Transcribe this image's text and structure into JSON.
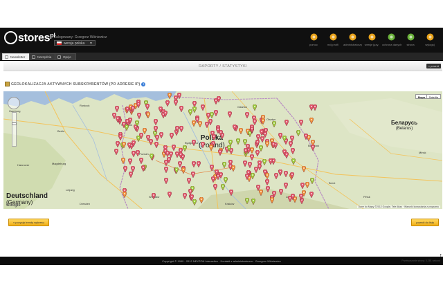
{
  "header": {
    "logo_text": "stores",
    "logo_suffix": "pl",
    "logged_as": "Zalogowany: Grzegorz Wiśniewicz",
    "language_select": "wersja polska",
    "icons": [
      {
        "name": "pomoc-icon",
        "label": "pomoc",
        "color": "#e9a31b"
      },
      {
        "name": "moj-profil-icon",
        "label": "mój profil",
        "color": "#e9a31b"
      },
      {
        "name": "administratorzy-icon",
        "label": "administratorzy",
        "color": "#e9a31b"
      },
      {
        "name": "wersja-jezykowa-icon",
        "label": "wersje języ.",
        "color": "#e9a31b"
      },
      {
        "name": "ochrona-danych-icon",
        "label": "ochrona danych",
        "color": "#6ab23a"
      },
      {
        "name": "home-icon",
        "label": "strona",
        "color": "#6ab23a"
      },
      {
        "name": "wyloguj-icon",
        "label": "wyloguj",
        "color": "#e9a31b"
      }
    ]
  },
  "tabs": [
    {
      "label": "Newsletter",
      "active": true
    },
    {
      "label": "Narzędzia",
      "active": false
    },
    {
      "label": "Opcje",
      "active": false
    }
  ],
  "page": {
    "title": "RAPORTY / STATYSTYKI",
    "back_button": "« powrót"
  },
  "section": {
    "title": "GEOLOKALIZACJA AKTYWNYCH SUBSKRYBENTÓW (PO ADRESIE IP)",
    "help": "?"
  },
  "map": {
    "type_buttons": [
      "Mapa",
      "Satelita"
    ],
    "country_poland": "Polska",
    "country_poland_en": "(Poland)",
    "country_germany": "Deutschland",
    "country_germany_en": "(Germany)",
    "country_belarus": "Беларусь",
    "country_belarus_en": "(Belarus)",
    "places": [
      "Hamburg",
      "Berlin",
      "Gdańsk",
      "Olsztyn",
      "Białystok",
      "Bydgoszcz",
      "Poznań",
      "Łódź",
      "Lublin",
      "Kraków",
      "Wrocław",
      "Minsk",
      "Brest",
      "Dresden",
      "Leipzig",
      "Magdeburg",
      "Hannover",
      "Rostock",
      "Szczecin",
      "Pińsk"
    ],
    "google": "Google",
    "attribution": "Dane do Mapy ©2012 Google, Tele Atlas · Warunki korzystania z programu"
  },
  "buttons": {
    "left": "« pozycja trendy wykresu",
    "right": "powrót do listy"
  },
  "footer": {
    "copyright": "Copyright © 1999 - 2012 NEXTON Interactive · Kontakt z administratorem · Grzegorz Wiśniewicz",
    "right": "Przetwarzanie strony: 0,281 sekund"
  }
}
